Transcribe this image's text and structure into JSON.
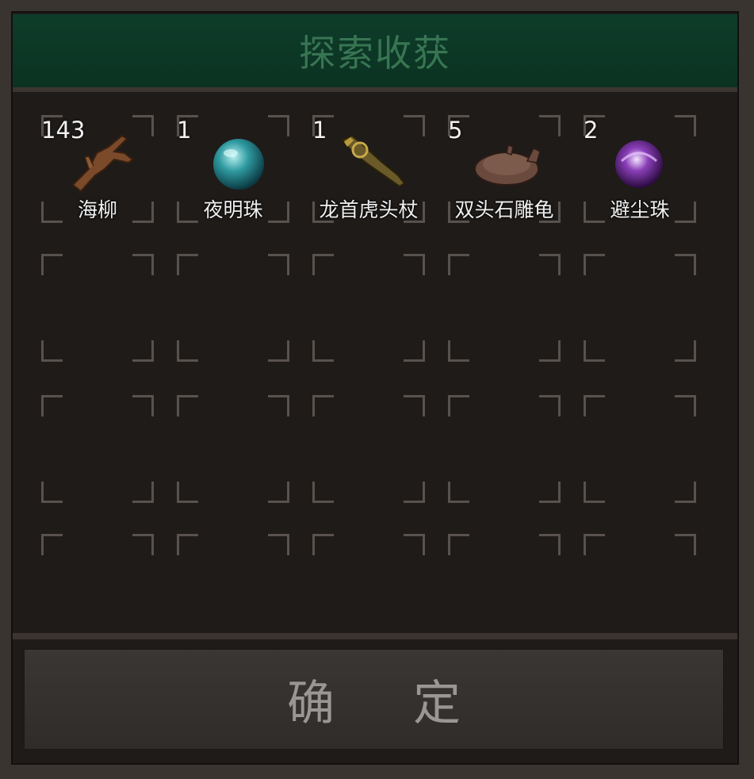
{
  "dialog": {
    "title": "探索收获",
    "confirm_label": "确 定"
  },
  "items": [
    {
      "name": "海柳",
      "count": "143",
      "icon": "driftwood-branch-icon"
    },
    {
      "name": "夜明珠",
      "count": "1",
      "icon": "luminous-pearl-icon"
    },
    {
      "name": "龙首虎头杖",
      "count": "1",
      "icon": "dragon-tiger-staff-icon"
    },
    {
      "name": "双头石雕龟",
      "count": "5",
      "icon": "stone-turtle-icon"
    },
    {
      "name": "避尘珠",
      "count": "2",
      "icon": "dust-pearl-icon"
    }
  ],
  "colors": {
    "title_bg": "#0e3d2a",
    "title_text": "#3d7c58",
    "panel_bg": "#1f1b19",
    "slot_corner": "#58524e"
  }
}
